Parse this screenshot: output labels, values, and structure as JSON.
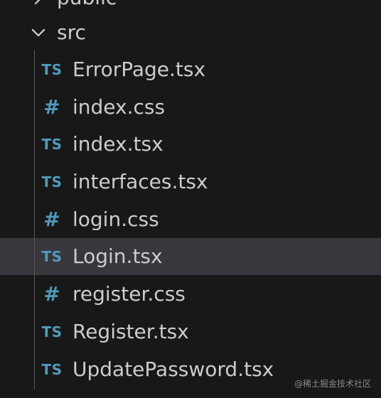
{
  "explorer": {
    "folders": [
      {
        "name": "public",
        "expanded": false
      },
      {
        "name": "src",
        "expanded": true
      }
    ],
    "files": [
      {
        "icon_text": "TS",
        "icon": "typescript-icon",
        "name": "ErrorPage.tsx"
      },
      {
        "icon_text": "#",
        "icon": "css-icon",
        "name": "index.css"
      },
      {
        "icon_text": "TS",
        "icon": "typescript-icon",
        "name": "index.tsx"
      },
      {
        "icon_text": "TS",
        "icon": "typescript-icon",
        "name": "interfaces.tsx"
      },
      {
        "icon_text": "#",
        "icon": "css-icon",
        "name": "login.css"
      },
      {
        "icon_text": "TS",
        "icon": "typescript-icon",
        "name": "Login.tsx",
        "selected": true
      },
      {
        "icon_text": "#",
        "icon": "css-icon",
        "name": "register.css"
      },
      {
        "icon_text": "TS",
        "icon": "typescript-icon",
        "name": "Register.tsx"
      },
      {
        "icon_text": "TS",
        "icon": "typescript-icon",
        "name": "UpdatePassword.tsx"
      }
    ]
  },
  "colors": {
    "background": "#181818",
    "text": "#cccccc",
    "icon": "#519aba",
    "selected_row": "#37373d",
    "indent_guide": "#585858"
  },
  "watermark": "@稀土掘金技术社区"
}
